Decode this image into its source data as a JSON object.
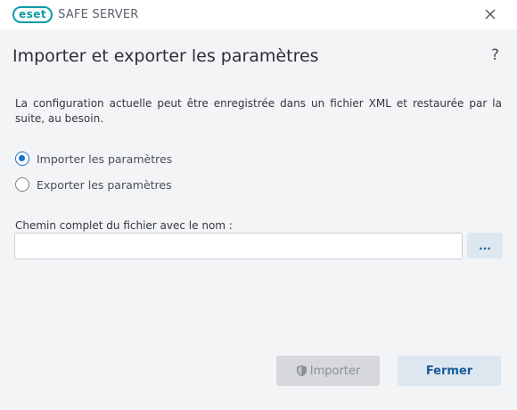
{
  "window": {
    "logo_text": "eset",
    "product": "SAFE SERVER",
    "close_icon": "close-icon"
  },
  "dialog": {
    "title": "Importer et exporter les paramètres",
    "help": "?",
    "description": "La configuration actuelle peut être enregistrée dans un fichier XML et restaurée par la suite, au besoin.",
    "options": [
      {
        "label": "Importer les paramètres",
        "selected": true
      },
      {
        "label": "Exporter les paramètres",
        "selected": false
      }
    ],
    "path_field": {
      "label": "Chemin complet du fichier avec le nom :",
      "value": "",
      "placeholder": ""
    },
    "browse_label": "...",
    "import_label": "Importer",
    "close_label": "Fermer"
  },
  "colors": {
    "accent": "#1a73c8",
    "brand": "#0c9aa6",
    "background": "#f3f4f6"
  }
}
